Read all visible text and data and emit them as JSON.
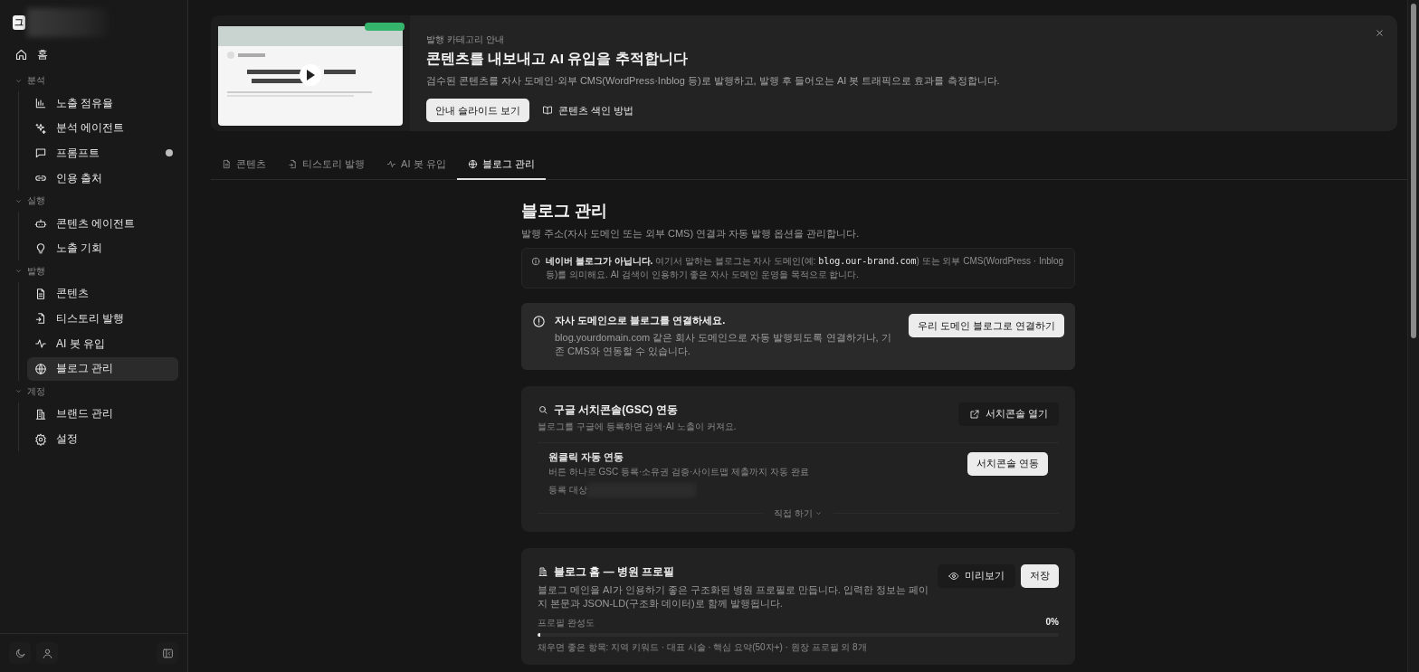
{
  "sidebar": {
    "logo": "그",
    "home": {
      "label": "홈",
      "selected": false
    },
    "sections": [
      {
        "title": "분석",
        "expanded": true,
        "items": [
          {
            "label": "노출 점유율",
            "selected": false,
            "notice": false
          },
          {
            "label": "분석 에이전트",
            "selected": false,
            "notice": false
          },
          {
            "label": "프롬프트",
            "selected": false,
            "notice": true
          },
          {
            "label": "인용 출처",
            "selected": false,
            "notice": false
          }
        ]
      },
      {
        "title": "실행",
        "expanded": true,
        "items": [
          {
            "label": "콘텐츠 에이전트",
            "selected": false,
            "notice": false
          },
          {
            "label": "노출 기회",
            "selected": false,
            "notice": false
          }
        ]
      },
      {
        "title": "발행",
        "expanded": true,
        "items": [
          {
            "label": "콘텐츠",
            "selected": false,
            "notice": false
          },
          {
            "label": "티스토리 발행",
            "selected": false,
            "notice": false
          },
          {
            "label": "AI 봇 유입",
            "selected": false,
            "notice": false
          },
          {
            "label": "블로그 관리",
            "selected": true,
            "notice": false
          }
        ]
      },
      {
        "title": "계정",
        "expanded": true,
        "items": [
          {
            "label": "브랜드 관리",
            "selected": false,
            "notice": false
          },
          {
            "label": "설정",
            "selected": false,
            "notice": false
          }
        ]
      }
    ]
  },
  "banner": {
    "eyebrow": "발행 카테고리 안내",
    "title": "콘텐츠를 내보내고 AI 유입을 추적합니다",
    "description": "검수된 콘텐츠를 자사 도메인·외부 CMS(WordPress·Inblog 등)로 발행하고, 발행 후 들어오는 AI 봇 트래픽으로 효과를 측정합니다.",
    "buttons": [
      {
        "label": "안내 슬라이드 보기",
        "kind": "primary"
      },
      {
        "label": "콘텐츠 색인 방법",
        "kind": "link"
      }
    ]
  },
  "tabs": [
    {
      "label": "콘텐츠",
      "selected": false
    },
    {
      "label": "티스토리 발행",
      "selected": false
    },
    {
      "label": "AI 봇 유입",
      "selected": false
    },
    {
      "label": "블로그 관리",
      "selected": true
    }
  ],
  "page": {
    "title": "블로그 관리",
    "subtitle": "발행 주소(자사 도메인 또는 외부 CMS) 연결과 자동 발행 옵션을 관리합니다.",
    "notice": {
      "lead": "네이버 블로그가 아닙니다.",
      "before": " 여기서 말하는 블로그는 자사 도메인(예: ",
      "code": "blog.our-brand.com",
      "after": ") 또는 외부 CMS(WordPress · Inblog 등)를 의미해요. AI 검색이 인용하기 좋은 자사 도메인 운영을 목적으로 합니다."
    },
    "alert": {
      "title": "자사 도메인으로 블로그를 연결하세요.",
      "text": "blog.yourdomain.com 같은 회사 도메인으로 자동 발행되도록 연결하거나, 기존 CMS와 연동할 수 있습니다.",
      "button": "우리 도메인 블로그로 연결하기"
    },
    "gsc": {
      "title": "구글 서치콘솔(GSC) 연동",
      "subtitle": "블로그를 구글에 등록하면 검색·AI 노출이 커져요.",
      "button": "서치콘솔 열기",
      "oneclick": {
        "title": "원클릭 자동 연동",
        "text": "버튼 하나로 GSC 등록·소유권 검증·사이트맵 제출까지 자동 완료",
        "target_label": "등록 대상",
        "button": "서치콘솔 연동"
      },
      "toggle": "직접 하기",
      "expanded": false
    },
    "profile": {
      "title": "블로그 홈 — 병원 프로필",
      "description": "블로그 메인을 AI가 인용하기 좋은 구조화된 병원 프로필로 만듭니다. 입력한 정보는 페이지 본문과 JSON-LD(구조화 데이터)로 함께 발행됩니다.",
      "buttons": [
        {
          "label": "미리보기",
          "kind": "preview"
        },
        {
          "label": "저장",
          "kind": "primary"
        }
      ],
      "progress_label": "프로필 완성도",
      "progress_value": "0%",
      "level": 0,
      "hint": "채우면 좋은 항목: 지역 키워드 · 대표 시술 · 핵심 요약(50자+) · 원장 프로필 외 8개"
    }
  }
}
